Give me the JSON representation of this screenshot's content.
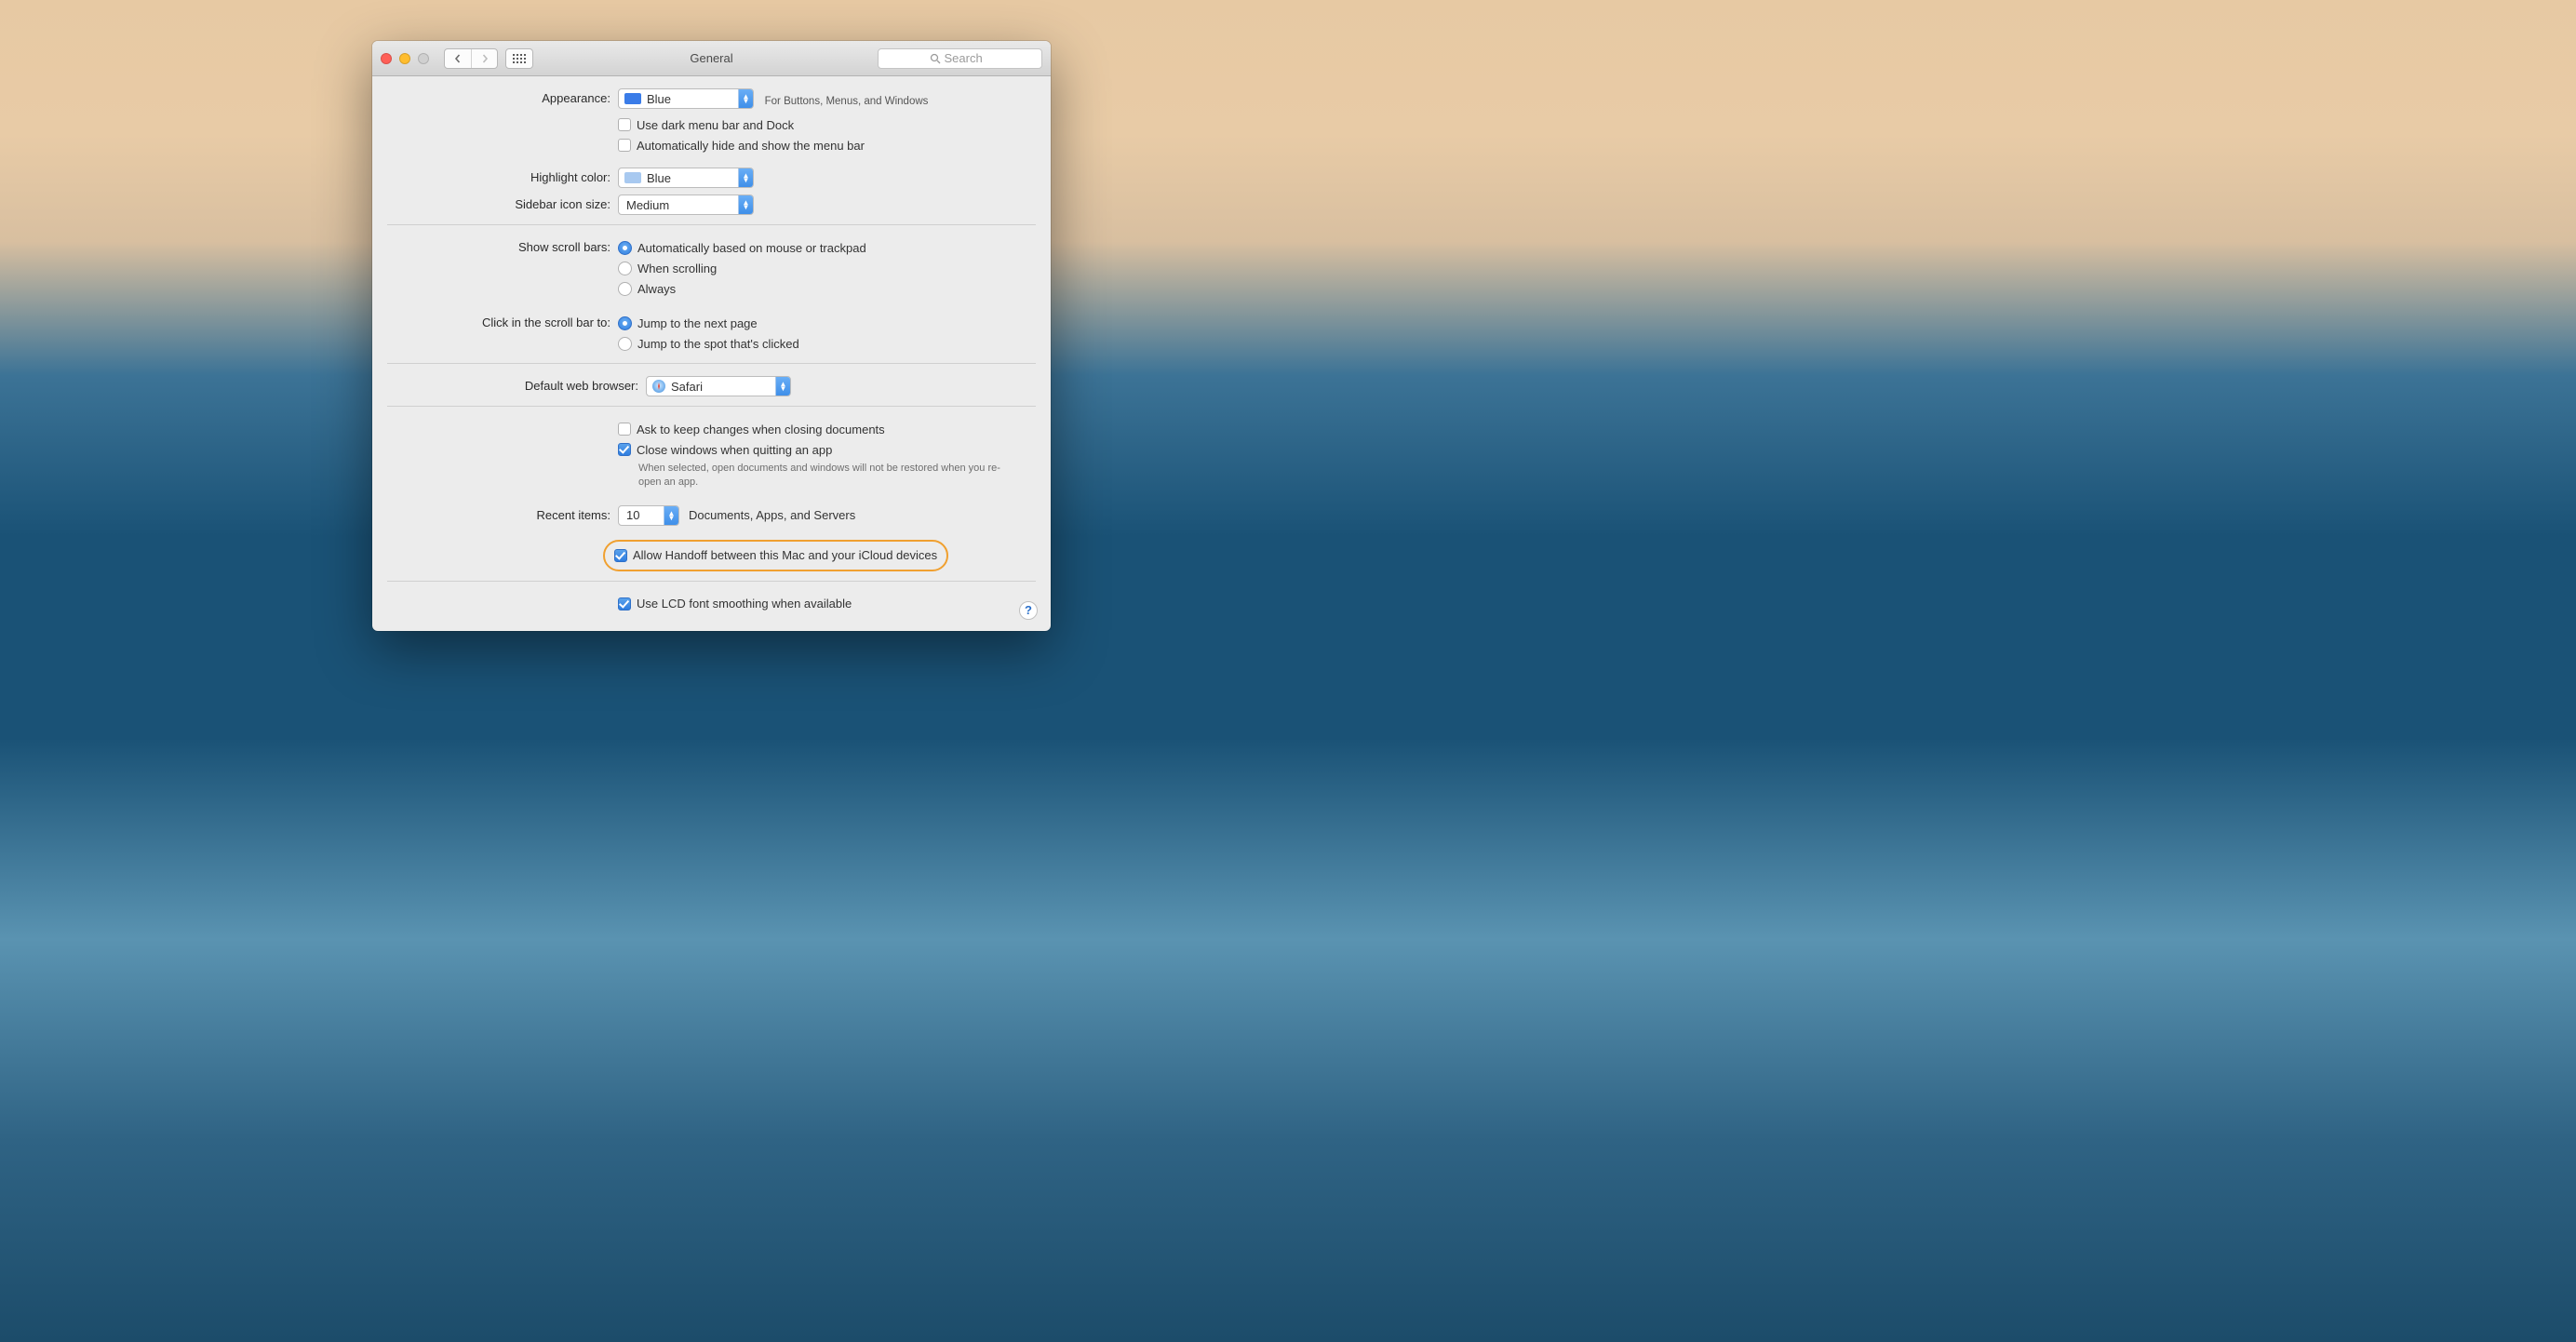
{
  "window": {
    "title": "General",
    "search_placeholder": "Search"
  },
  "appearance": {
    "label": "Appearance:",
    "value": "Blue",
    "hint": "For Buttons, Menus, and Windows",
    "swatch_color": "#3a7ce8",
    "dark_menu_label": "Use dark menu bar and Dock",
    "dark_menu_checked": false,
    "autohide_label": "Automatically hide and show the menu bar",
    "autohide_checked": false
  },
  "highlight": {
    "label": "Highlight color:",
    "value": "Blue",
    "swatch_color": "#a8c9f0"
  },
  "sidebar": {
    "label": "Sidebar icon size:",
    "value": "Medium"
  },
  "scrollbars": {
    "label": "Show scroll bars:",
    "options": [
      {
        "label": "Automatically based on mouse or trackpad",
        "selected": true
      },
      {
        "label": "When scrolling",
        "selected": false
      },
      {
        "label": "Always",
        "selected": false
      }
    ]
  },
  "scrollclick": {
    "label": "Click in the scroll bar to:",
    "options": [
      {
        "label": "Jump to the next page",
        "selected": true
      },
      {
        "label": "Jump to the spot that's clicked",
        "selected": false
      }
    ]
  },
  "browser": {
    "label": "Default web browser:",
    "value": "Safari"
  },
  "documents": {
    "ask_label": "Ask to keep changes when closing documents",
    "ask_checked": false,
    "close_label": "Close windows when quitting an app",
    "close_checked": true,
    "close_note": "When selected, open documents and windows will not be restored when you re-open an app."
  },
  "recent": {
    "label": "Recent items:",
    "value": "10",
    "suffix": "Documents, Apps, and Servers"
  },
  "handoff": {
    "label": "Allow Handoff between this Mac and your iCloud devices",
    "checked": true
  },
  "lcd": {
    "label": "Use LCD font smoothing when available",
    "checked": true
  },
  "help_label": "?"
}
